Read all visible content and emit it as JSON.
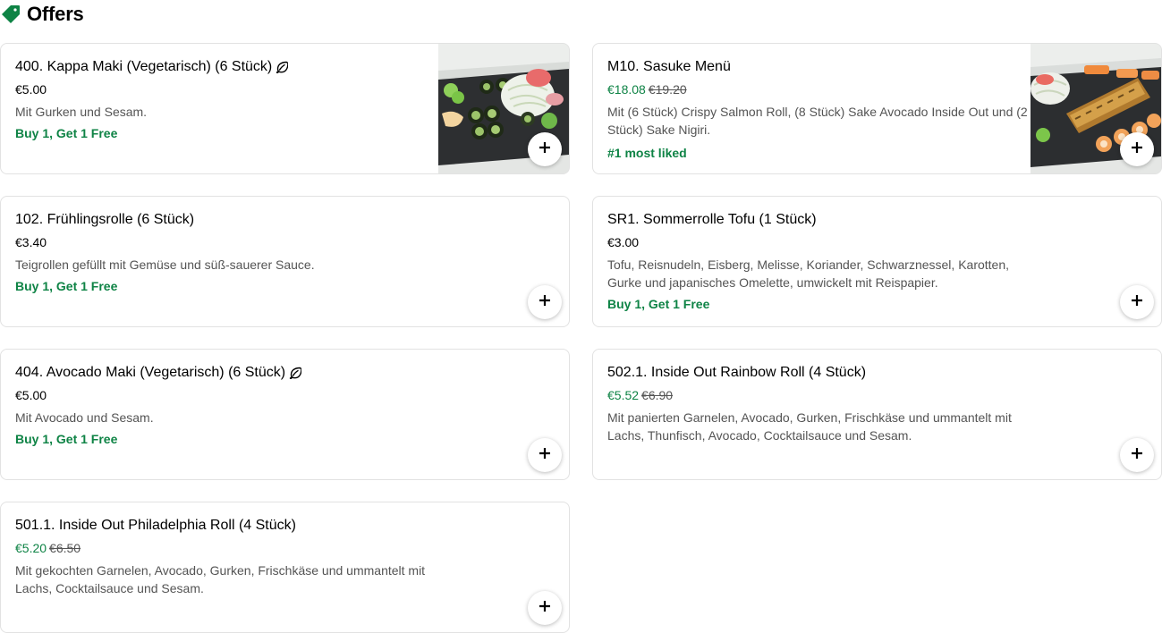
{
  "section": {
    "title": "Offers",
    "icon": "tag-icon",
    "accent": "#0e8345"
  },
  "items": [
    {
      "title": "400. Kappa Maki (Vegetarisch) (6 Stück)",
      "vegetarian": true,
      "price": "€5.00",
      "old_price": "",
      "description": "Mit Gurken und Sesam.",
      "promo": "Buy 1, Get 1 Free",
      "has_image": true
    },
    {
      "title": "M10. Sasuke Menü",
      "vegetarian": false,
      "price": "€18.08",
      "old_price": "€19.20",
      "description": "Mit (6 Stück) Crispy Salmon Roll, (8 Stück) Sake Avocado Inside Out und (2 Stück) Sake Nigiri.",
      "promo": "#1 most liked",
      "has_image": true
    },
    {
      "title": "102. Frühlingsrolle (6 Stück)",
      "vegetarian": false,
      "price": "€3.40",
      "old_price": "",
      "description": "Teigrollen gefüllt mit Gemüse und süß-sauerer Sauce.",
      "promo": "Buy 1, Get 1 Free",
      "has_image": false
    },
    {
      "title": "SR1. Sommerrolle Tofu (1 Stück)",
      "vegetarian": false,
      "price": "€3.00",
      "old_price": "",
      "description": "Tofu, Reisnudeln, Eisberg, Melisse, Koriander, Schwarznessel, Karotten, Gurke und japanisches Omelette, umwickelt mit Reispapier.",
      "promo": "Buy 1, Get 1 Free",
      "has_image": false
    },
    {
      "title": "404. Avocado Maki (Vegetarisch) (6 Stück)",
      "vegetarian": true,
      "price": "€5.00",
      "old_price": "",
      "description": "Mit Avocado und Sesam.",
      "promo": "Buy 1, Get 1 Free",
      "has_image": false
    },
    {
      "title": "502.1. Inside Out Rainbow Roll (4 Stück)",
      "vegetarian": false,
      "price": "€5.52",
      "old_price": "€6.90",
      "description": "Mit panierten Garnelen, Avocado, Gurken, Frischkäse und ummantelt mit Lachs, Thunfisch, Avocado, Cocktailsauce und Sesam.",
      "promo": "",
      "has_image": false
    },
    {
      "title": "501.1. Inside Out Philadelphia Roll (4 Stück)",
      "vegetarian": false,
      "price": "€5.20",
      "old_price": "€6.50",
      "description": "Mit gekochten Garnelen, Avocado, Gurken, Frischkäse und ummantelt mit Lachs, Cocktailsauce und Sesam.",
      "promo": "",
      "has_image": false
    }
  ],
  "add_button_icon": "plus-icon"
}
